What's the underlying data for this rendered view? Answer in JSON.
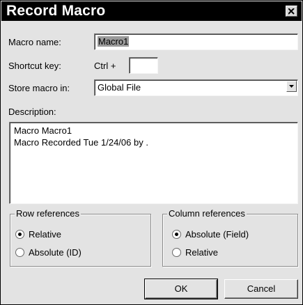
{
  "window": {
    "title": "Record Macro"
  },
  "macro_name": {
    "label": "Macro name:",
    "value": "Macro1"
  },
  "shortcut": {
    "label": "Shortcut key:",
    "modifier": "Ctrl +",
    "value": ""
  },
  "store": {
    "label": "Store macro in:",
    "selected": "Global File"
  },
  "description": {
    "label": "Description:",
    "line1": "Macro Macro1",
    "line2": "Macro Recorded Tue 1/24/06 by  ."
  },
  "row_references": {
    "legend": "Row references",
    "options": [
      {
        "label": "Relative",
        "selected": true
      },
      {
        "label": "Absolute (ID)",
        "selected": false
      }
    ]
  },
  "column_references": {
    "legend": "Column references",
    "options": [
      {
        "label": "Absolute (Field)",
        "selected": true
      },
      {
        "label": "Relative",
        "selected": false
      }
    ]
  },
  "buttons": {
    "ok": "OK",
    "cancel": "Cancel"
  },
  "icons": {
    "close": "close-icon",
    "dropdown": "chevron-down-icon",
    "radio": "radio-icon"
  }
}
